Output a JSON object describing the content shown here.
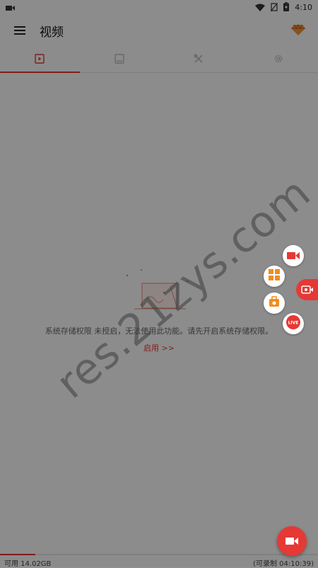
{
  "status_bar": {
    "time": "4:10"
  },
  "app_bar": {
    "title": "视频"
  },
  "tabs": [
    {
      "id": "videos",
      "icon": "video-icon",
      "active": true
    },
    {
      "id": "images",
      "icon": "image-icon",
      "active": false
    },
    {
      "id": "tools",
      "icon": "tools-icon",
      "active": false
    },
    {
      "id": "settings",
      "icon": "gear-icon",
      "active": false
    }
  ],
  "empty_state": {
    "message": "系统存储权限 未授启，无法使用此功能。请先开启系统存储权限。",
    "enable_link": "启用 >>"
  },
  "storage": {
    "available": "可用 14.02GB",
    "record_time": "(可录制 04:10:39)",
    "used_fraction": 0.11
  },
  "watermark": {
    "text": "res.21zys.com"
  },
  "bubble": {
    "live_label": "LIVE"
  },
  "colors": {
    "accent": "#e53935",
    "overlay": "rgba(0,0,0,0.45)"
  }
}
